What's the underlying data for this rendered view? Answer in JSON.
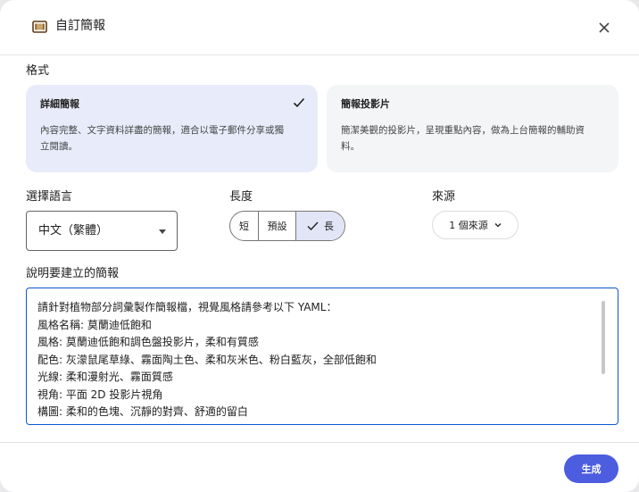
{
  "dialog": {
    "title": "自訂簡報",
    "title_icon": "slides-icon",
    "close_icon": "close-icon"
  },
  "format": {
    "label": "格式",
    "options": [
      {
        "title": "詳細簡報",
        "description_line1": "內容完整、文字資料詳盡的簡報，適合以電子郵件分享或獨",
        "description_line2": "立閱讀。",
        "selected": true
      },
      {
        "title": "簡報投影片",
        "description_line1": "簡潔美觀的投影片，呈現重點內容，做為上台簡報的輔助資",
        "description_line2": "料。",
        "selected": false
      }
    ]
  },
  "language": {
    "label": "選擇語言",
    "value": "中文（繁體）"
  },
  "length": {
    "label": "長度",
    "options": [
      "短",
      "預設",
      "長"
    ],
    "selected": "長"
  },
  "source": {
    "label": "來源",
    "value": "1 個來源"
  },
  "description": {
    "label": "說明要建立的簡報",
    "lines": [
      "請針對植物部分詞彙製作簡報檔，視覺風格請參考以下 YAML：",
      "風格名稱: 莫蘭迪低飽和",
      "風格: 莫蘭迪低飽和調色盤投影片，柔和有質感",
      "配色: 灰濛鼠尾草綠、霧面陶土色、柔和灰米色、粉白藍灰，全部低飽和",
      "光線: 柔和漫射光、霧面質感",
      "視角: 平面 2D 投影片視角",
      "構圖: 柔和的色塊、沉靜的對齊、舒適的留白"
    ]
  },
  "footer": {
    "generate_label": "生成"
  },
  "colors": {
    "accent": "#4c5ddf",
    "selected_card": "#e8ebf9",
    "focus_border": "#0b57d0"
  }
}
